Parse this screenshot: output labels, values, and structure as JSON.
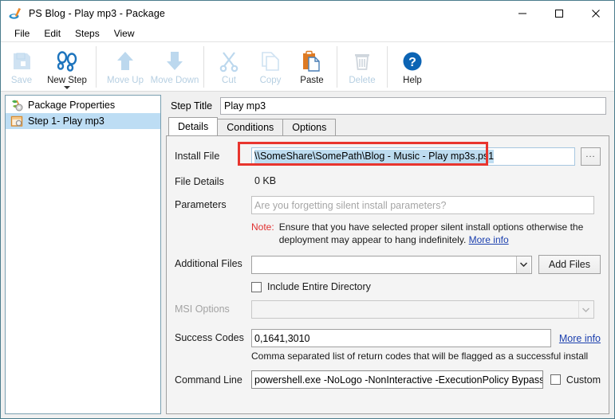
{
  "window": {
    "title": "PS Blog - Play mp3 - Package",
    "app_icon": "app-icon",
    "controls": {
      "minimize": "minimize-icon",
      "maximize": "maximize-icon",
      "close": "close-icon"
    }
  },
  "menubar": {
    "items": [
      {
        "label": "File"
      },
      {
        "label": "Edit"
      },
      {
        "label": "Steps"
      },
      {
        "label": "View"
      }
    ]
  },
  "toolbar": {
    "items": [
      {
        "label": "Save",
        "icon": "save-icon",
        "enabled": false
      },
      {
        "label": "New Step",
        "icon": "new-step-icon",
        "enabled": true,
        "has_dropdown": true
      },
      {
        "label": "Move Up",
        "icon": "arrow-up-icon",
        "enabled": false
      },
      {
        "label": "Move Down",
        "icon": "arrow-down-icon",
        "enabled": false
      },
      {
        "label": "Cut",
        "icon": "scissors-icon",
        "enabled": false
      },
      {
        "label": "Copy",
        "icon": "copy-icon",
        "enabled": false
      },
      {
        "label": "Paste",
        "icon": "paste-icon",
        "enabled": true
      },
      {
        "label": "Delete",
        "icon": "trash-icon",
        "enabled": false
      },
      {
        "label": "Help",
        "icon": "question-mark-icon",
        "enabled": true
      }
    ]
  },
  "sidebar": {
    "items": [
      {
        "label": "Package Properties",
        "icon": "package-properties-icon",
        "selected": false
      },
      {
        "label": "Step 1- Play mp3",
        "icon": "step-icon",
        "selected": true
      }
    ]
  },
  "step_title": {
    "label": "Step Title",
    "value": "Play mp3"
  },
  "tabs": [
    {
      "label": "Details",
      "active": true
    },
    {
      "label": "Conditions",
      "active": false
    },
    {
      "label": "Options",
      "active": false
    }
  ],
  "details": {
    "install_file": {
      "label": "Install File",
      "value": "\\\\SomeShare\\SomePath\\Blog - Music - Play mp3s.ps1",
      "selected": true,
      "browse_label": "...",
      "highlight_color": "#e8352e"
    },
    "file_details": {
      "label": "File Details",
      "value": "0 KB"
    },
    "parameters": {
      "label": "Parameters",
      "value": "",
      "placeholder": "Are you forgetting silent install parameters?"
    },
    "note": {
      "tag": "Note:",
      "text": "Ensure that you have selected proper silent install options otherwise the deployment may appear to hang indefinitely.",
      "link_label": "More info",
      "tag_color": "#e03030"
    },
    "additional_files": {
      "label": "Additional Files",
      "value": "",
      "button_label": "Add Files"
    },
    "include_entire_directory": {
      "label": "Include Entire Directory",
      "checked": false
    },
    "msi_options": {
      "label": "MSI Options",
      "value": "",
      "enabled": false
    },
    "success_codes": {
      "label": "Success Codes",
      "value": "0,1641,3010",
      "link_label": "More info",
      "helper": "Comma separated list of return codes that will be flagged as a successful install"
    },
    "command_line": {
      "label": "Command Line",
      "value": "powershell.exe -NoLogo -NonInteractive -ExecutionPolicy Bypass -Fil",
      "custom_label": "Custom",
      "custom_checked": false
    }
  }
}
